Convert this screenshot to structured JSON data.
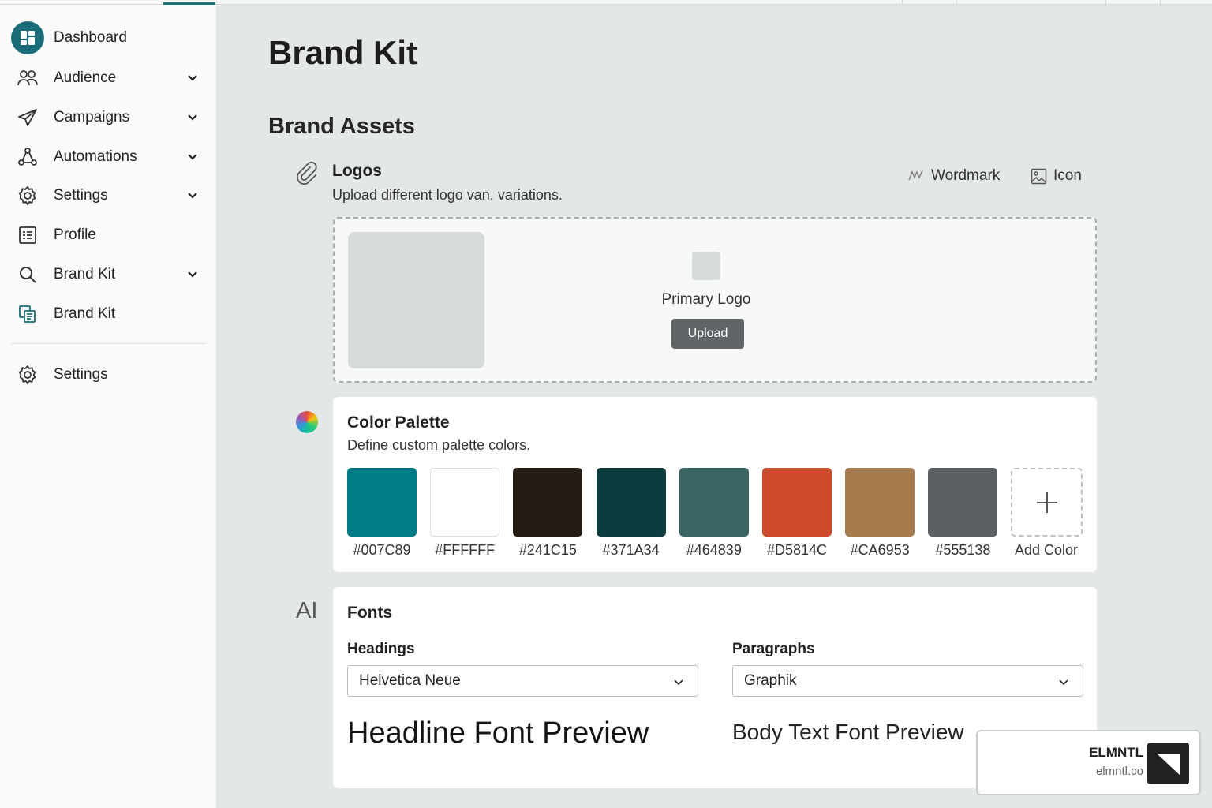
{
  "sidebar": {
    "items": [
      {
        "label": "Dashboard",
        "icon": "dashboard-icon"
      },
      {
        "label": "Audience",
        "icon": "audience-icon"
      },
      {
        "label": "Campaigns",
        "icon": "campaigns-icon"
      },
      {
        "label": "Automations",
        "icon": "automations-icon"
      },
      {
        "label": "Settings",
        "icon": "settings-icon"
      },
      {
        "label": "Profile",
        "icon": "profile-icon"
      },
      {
        "label": "Brand Kit",
        "icon": "search-icon"
      },
      {
        "label": "Brand Kit",
        "icon": "brand-kit-icon"
      }
    ],
    "bottom_items": [
      {
        "label": "Settings",
        "icon": "settings-icon"
      }
    ],
    "accent_color": "#1a6d78"
  },
  "page": {
    "title": "Brand Kit",
    "section_title": "Brand Assets"
  },
  "logos": {
    "title": "Logos",
    "description": "Upload different logo van. variations.",
    "tabs": [
      {
        "label": "Wordmark",
        "icon": "wordmark-icon"
      },
      {
        "label": "Icon",
        "icon": "image-icon"
      }
    ],
    "drop_label": "Primary Logo",
    "upload_label": "Upload"
  },
  "palette": {
    "title": "Color Palette",
    "description": "Define custom palette colors.",
    "colors": [
      {
        "label": "#007C89",
        "color": "#007C89"
      },
      {
        "label": "#FFFFFF",
        "color": "#FFFFFF"
      },
      {
        "label": "#241C15",
        "color": "#241C15"
      },
      {
        "label": "#371A34",
        "color": "#0E3B3E"
      },
      {
        "label": "#464839",
        "color": "#3A6563"
      },
      {
        "label": "#D5814C",
        "color": "#CD4A2C"
      },
      {
        "label": "#CA6953",
        "color": "#A67C4E"
      },
      {
        "label": "#555138",
        "color": "#5B5F63"
      }
    ],
    "add_label": "Add Color"
  },
  "fonts": {
    "title": "Fonts",
    "headings_label": "Headings",
    "headings_value": "Helvetica Neue",
    "paragraphs_label": "Paragraphs",
    "paragraphs_value": "Graphik",
    "headline_preview": "Headline Font Preview",
    "body_preview": "Body Text Font Preview",
    "icon_text": "AI"
  },
  "badge": {
    "name": "ELMNTL",
    "url": "elmntl.co"
  }
}
